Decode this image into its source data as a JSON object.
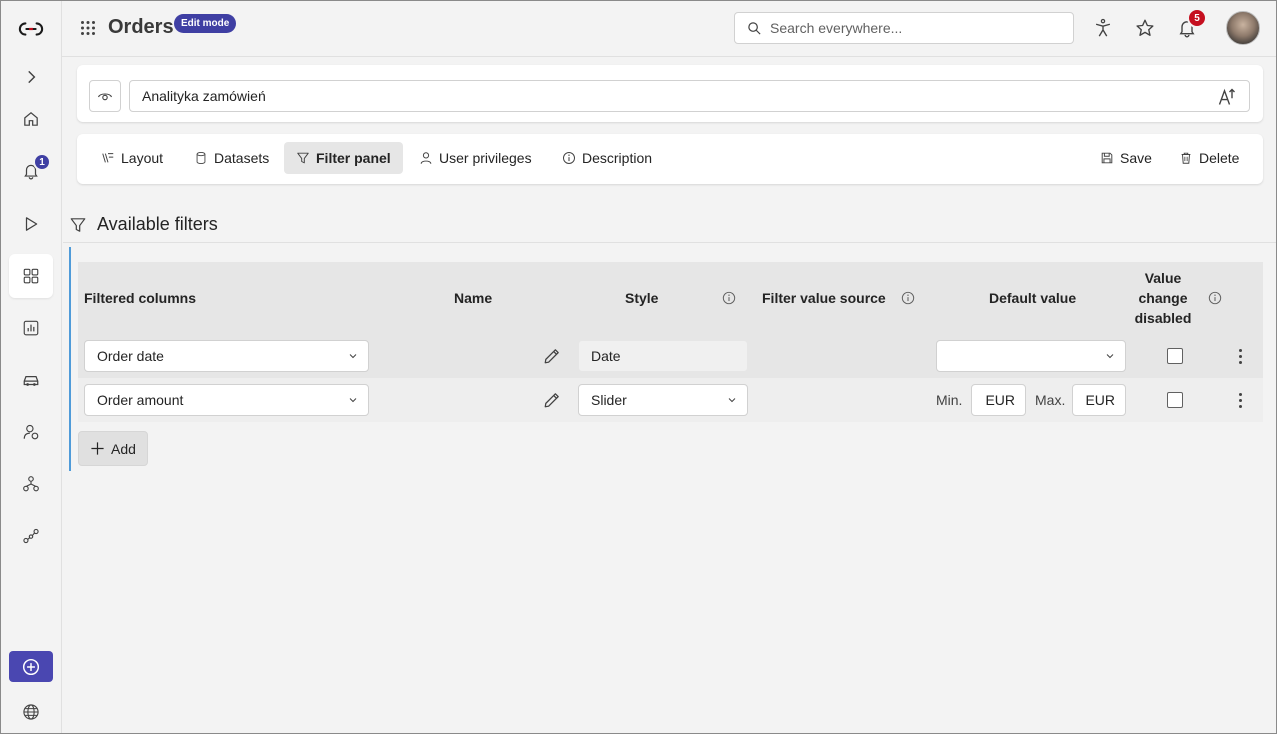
{
  "header": {
    "title": "Orders",
    "mode_badge": "Edit mode",
    "search_placeholder": "Search everywhere...",
    "notification_count": "5"
  },
  "rail": {
    "notification_count": "1",
    "items": [
      "expand",
      "home",
      "notifications",
      "run",
      "apps",
      "reports",
      "vehicles",
      "users",
      "hierarchy",
      "connections"
    ],
    "bottom": [
      "add",
      "language"
    ]
  },
  "report": {
    "name": "Analityka zamówień"
  },
  "tabs": [
    {
      "label": "Layout",
      "icon": "layout-icon"
    },
    {
      "label": "Datasets",
      "icon": "database-icon"
    },
    {
      "label": "Filter panel",
      "icon": "filter-icon",
      "active": true
    },
    {
      "label": "User privileges",
      "icon": "person-icon"
    },
    {
      "label": "Description",
      "icon": "info-icon"
    }
  ],
  "actions": {
    "save": "Save",
    "delete": "Delete"
  },
  "section": {
    "title": "Available filters"
  },
  "table": {
    "headers": {
      "filtered_columns": "Filtered columns",
      "name": "Name",
      "style": "Style",
      "filter_value_source": "Filter value source",
      "default_value": "Default value",
      "value_change_disabled_1": "Value",
      "value_change_disabled_2": "change",
      "value_change_disabled_3": "disabled"
    },
    "rows": [
      {
        "column": "Order date",
        "style": "Date",
        "default_value": "",
        "value_change_disabled": false
      },
      {
        "column": "Order amount",
        "style": "Slider",
        "min_label": "Min.",
        "min_currency": "EUR",
        "max_label": "Max.",
        "max_currency": "EUR",
        "value_change_disabled": false
      }
    ]
  },
  "add_label": "Add",
  "colors": {
    "accent": "#3f3fa3",
    "notif": "#c50f1f",
    "rail_add": "#4a47b1",
    "left_accent": "#4f9bd9"
  }
}
